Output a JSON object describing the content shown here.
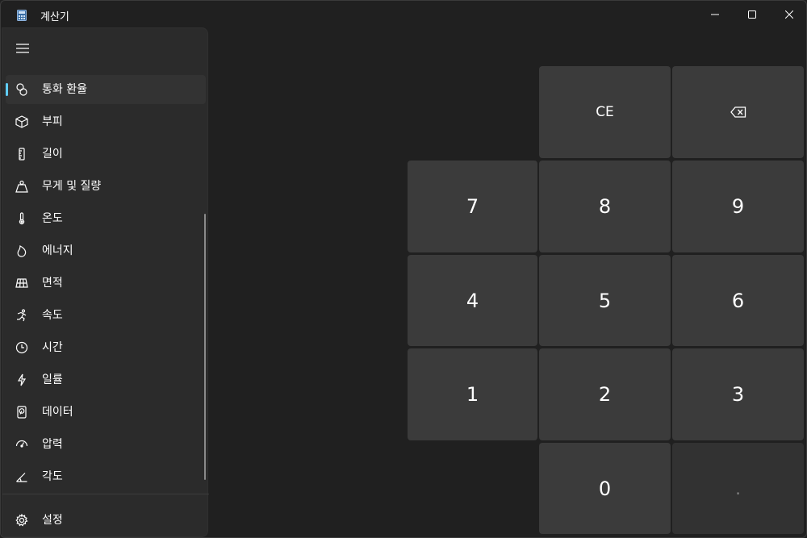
{
  "app": {
    "title": "계산기",
    "icon": "calculator-icon"
  },
  "window_controls": {
    "minimize_icon": "minimize-icon",
    "maximize_icon": "maximize-icon",
    "close_icon": "close-icon"
  },
  "nav": {
    "menu_icon": "hamburger-icon",
    "selected_index": 0,
    "accent_color": "#60cdff",
    "items": [
      {
        "label": "통화 환율",
        "icon": "currency-icon"
      },
      {
        "label": "부피",
        "icon": "cube-icon"
      },
      {
        "label": "길이",
        "icon": "ruler-icon"
      },
      {
        "label": "무게 및 질량",
        "icon": "weight-icon"
      },
      {
        "label": "온도",
        "icon": "thermometer-icon"
      },
      {
        "label": "에너지",
        "icon": "flame-icon"
      },
      {
        "label": "면적",
        "icon": "area-icon"
      },
      {
        "label": "속도",
        "icon": "runner-icon"
      },
      {
        "label": "시간",
        "icon": "clock-icon"
      },
      {
        "label": "일률",
        "icon": "lightning-icon"
      },
      {
        "label": "데이터",
        "icon": "data-icon"
      },
      {
        "label": "압력",
        "icon": "gauge-icon"
      },
      {
        "label": "각도",
        "icon": "angle-icon"
      }
    ],
    "settings": {
      "label": "설정",
      "icon": "gear-icon"
    }
  },
  "keypad": {
    "ce": "CE",
    "backspace_icon": "backspace-icon",
    "k7": "7",
    "k8": "8",
    "k9": "9",
    "k4": "4",
    "k5": "5",
    "k6": "6",
    "k1": "1",
    "k2": "2",
    "k3": "3",
    "k0": "0",
    "dot": "."
  }
}
